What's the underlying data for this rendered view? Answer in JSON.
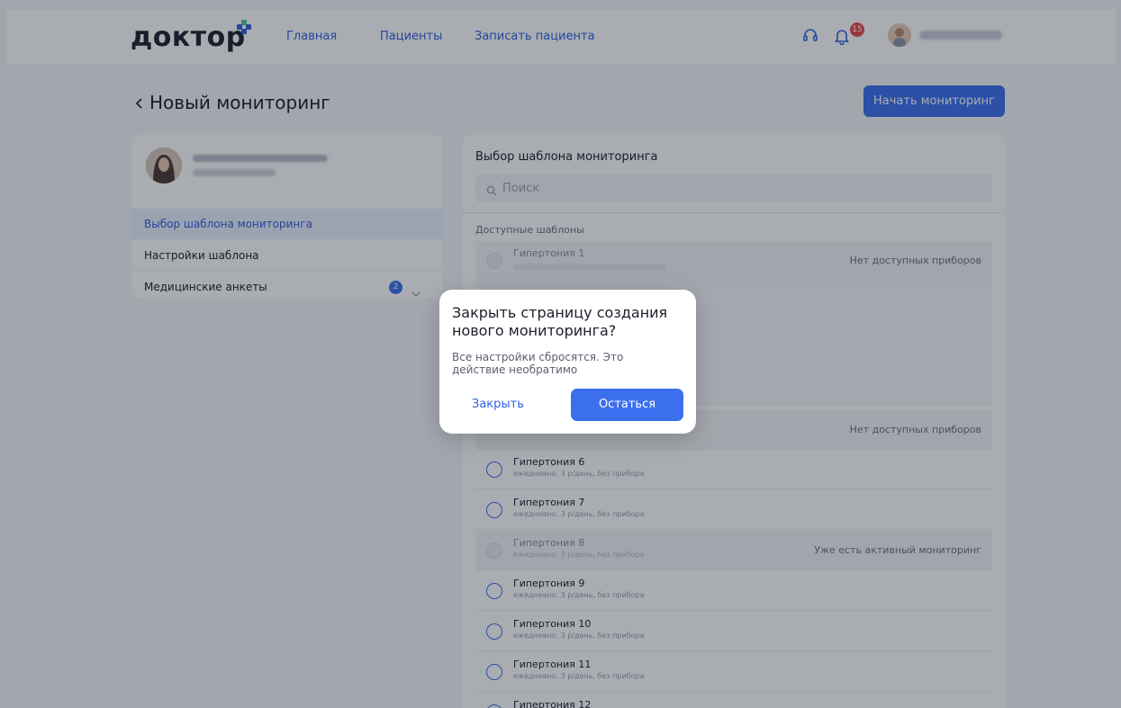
{
  "header": {
    "logo": "доктор",
    "nav": [
      "Главная",
      "Пациенты",
      "Записать пациента"
    ],
    "notification_count": "15",
    "icons": [
      "headset-icon",
      "bell-icon"
    ],
    "accent_color": "#3b6fee"
  },
  "page": {
    "title": "Новый мониторинг",
    "start_button": "Начать мониторинг"
  },
  "left_menu": {
    "items": [
      {
        "label": "Выбор шаблона мониторинга",
        "active": true
      },
      {
        "label": "Настройки шаблона"
      },
      {
        "label": "Медицинские анкеты",
        "badge": "2"
      }
    ]
  },
  "templates": {
    "title": "Выбор шаблона мониторинга",
    "search_placeholder": "Поиск",
    "available_label": "Доступные шаблоны",
    "items": [
      {
        "name": "Гипертония 1",
        "status": "Нет доступных приборов",
        "disabled": true
      },
      {
        "status": "Нет доступных приборов",
        "disabled": true
      },
      {
        "name": "Гипертония 6",
        "sub": "ежедневно, 3 р/день, без прибора"
      },
      {
        "name": "Гипертония 7",
        "sub": "ежедневно, 3 р/день, без прибора"
      },
      {
        "name": "Гипертония 8",
        "sub": "ежедневно, 3 р/день, без прибора",
        "status": "Уже есть активный мониторинг",
        "disabled": true
      },
      {
        "name": "Гипертония 9",
        "sub": "ежедневно, 3 р/день, без прибора"
      },
      {
        "name": "Гипертония 10",
        "sub": "ежедневно, 3 р/день, без прибора"
      },
      {
        "name": "Гипертония 11",
        "sub": "ежедневно, 3 р/день, без прибора"
      },
      {
        "name": "Гипертония 12"
      }
    ]
  },
  "modal": {
    "title": "Закрыть страницу создания нового мониторинга?",
    "text": "Все настройки сбросятся. Это действие необратимо",
    "close_label": "Закрыть",
    "stay_label": "Остаться"
  }
}
